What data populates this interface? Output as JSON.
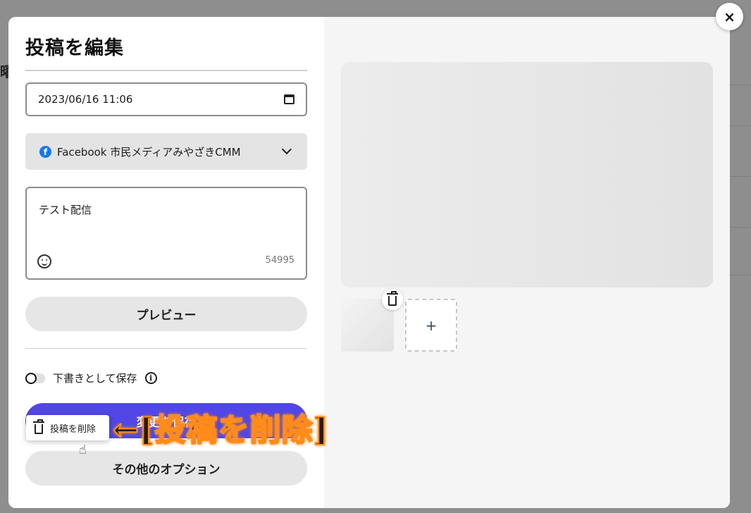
{
  "background": {
    "partial_text": "曜"
  },
  "modal": {
    "title": "投稿を編集",
    "datetime_value": "2023/06/16  11:06",
    "account": {
      "icon": "facebook-icon",
      "label": "Facebook 市民メディアみやざきCMM"
    },
    "message": {
      "value": "テスト配信",
      "remaining_chars": "54995"
    },
    "preview_label": "プレビュー",
    "draft_toggle": {
      "label": "下書きとして保存",
      "checked": false
    },
    "primary_button_label": "変更を保存",
    "delete_menu_label": "投稿を削除",
    "more_options_label": "その他のオプション",
    "add_media_symbol": "+",
    "close_symbol": "×"
  },
  "annotation": {
    "text": "←[投稿を削除]",
    "color": "#ff8c1a"
  },
  "colors": {
    "primary": "#5146e6",
    "facebook": "#1877f2"
  }
}
